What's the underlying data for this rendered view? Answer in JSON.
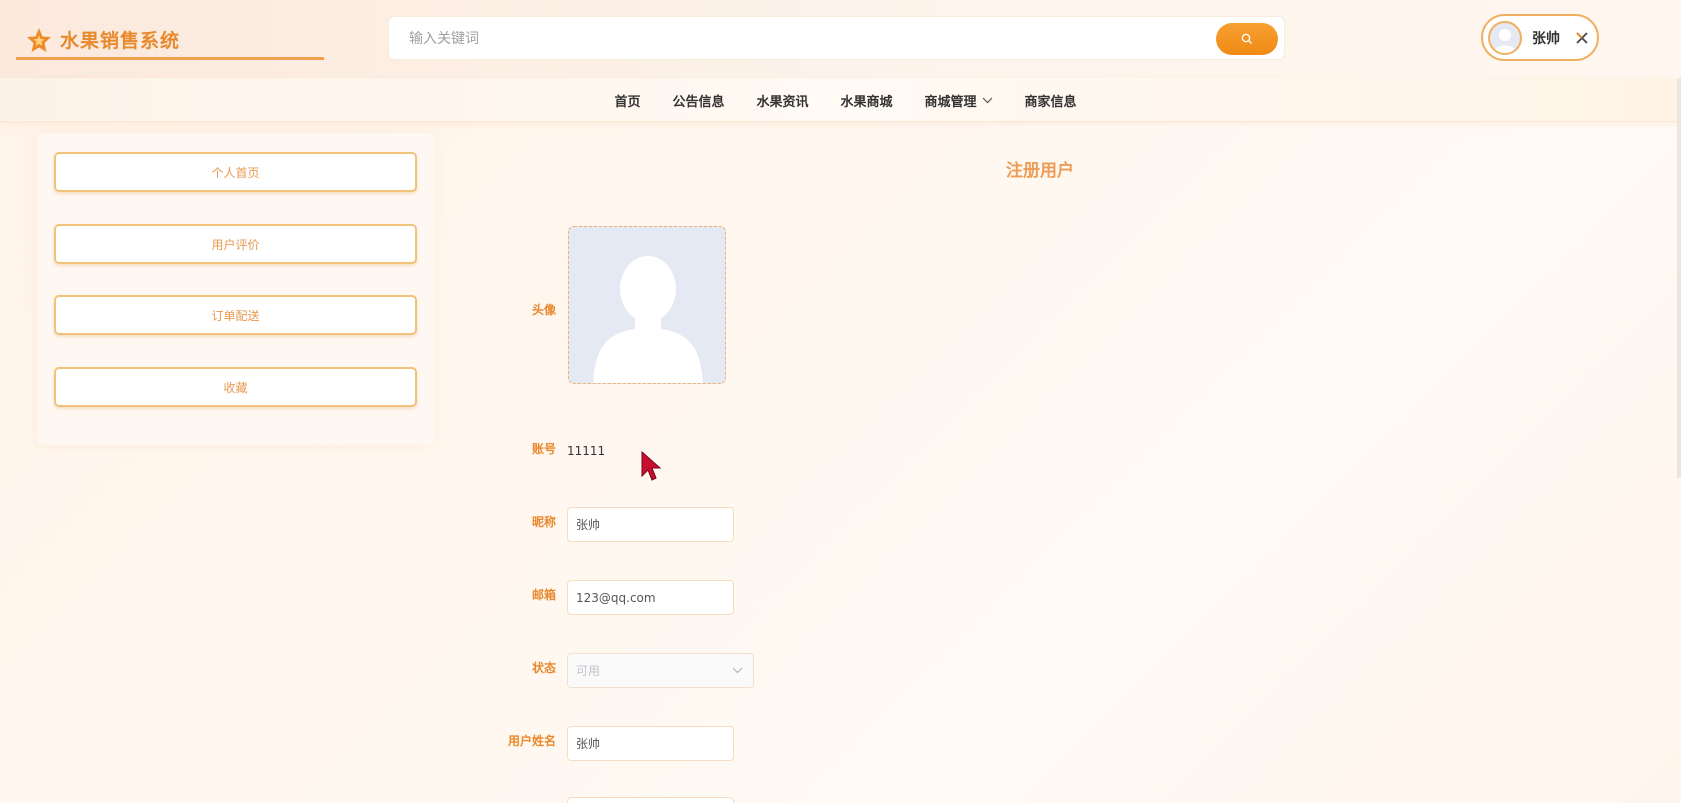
{
  "header": {
    "site_title": "水果销售系统",
    "search_placeholder": "输入关键词",
    "user_name": "张帅"
  },
  "nav": {
    "items": [
      {
        "label": "首页",
        "has_dropdown": false
      },
      {
        "label": "公告信息",
        "has_dropdown": false
      },
      {
        "label": "水果资讯",
        "has_dropdown": false
      },
      {
        "label": "水果商城",
        "has_dropdown": false
      },
      {
        "label": "商城管理",
        "has_dropdown": true
      },
      {
        "label": "商家信息",
        "has_dropdown": false
      }
    ]
  },
  "sidebar": {
    "items": [
      {
        "label": "个人首页"
      },
      {
        "label": "用户评价"
      },
      {
        "label": "订单配送"
      },
      {
        "label": "收藏"
      }
    ]
  },
  "form": {
    "title": "注册用户",
    "avatar_label": "头像",
    "account_label": "账号",
    "account_value": "11111",
    "nickname_label": "昵称",
    "nickname_value": "张帅",
    "email_label": "邮箱",
    "email_value": "123@qq.com",
    "status_label": "状态",
    "status_value": "可用",
    "realname_label": "用户姓名",
    "realname_value": "张帅"
  },
  "colors": {
    "accent": "#f08a14",
    "label_orange": "#e8892e",
    "button_border": "#f1c27a"
  }
}
